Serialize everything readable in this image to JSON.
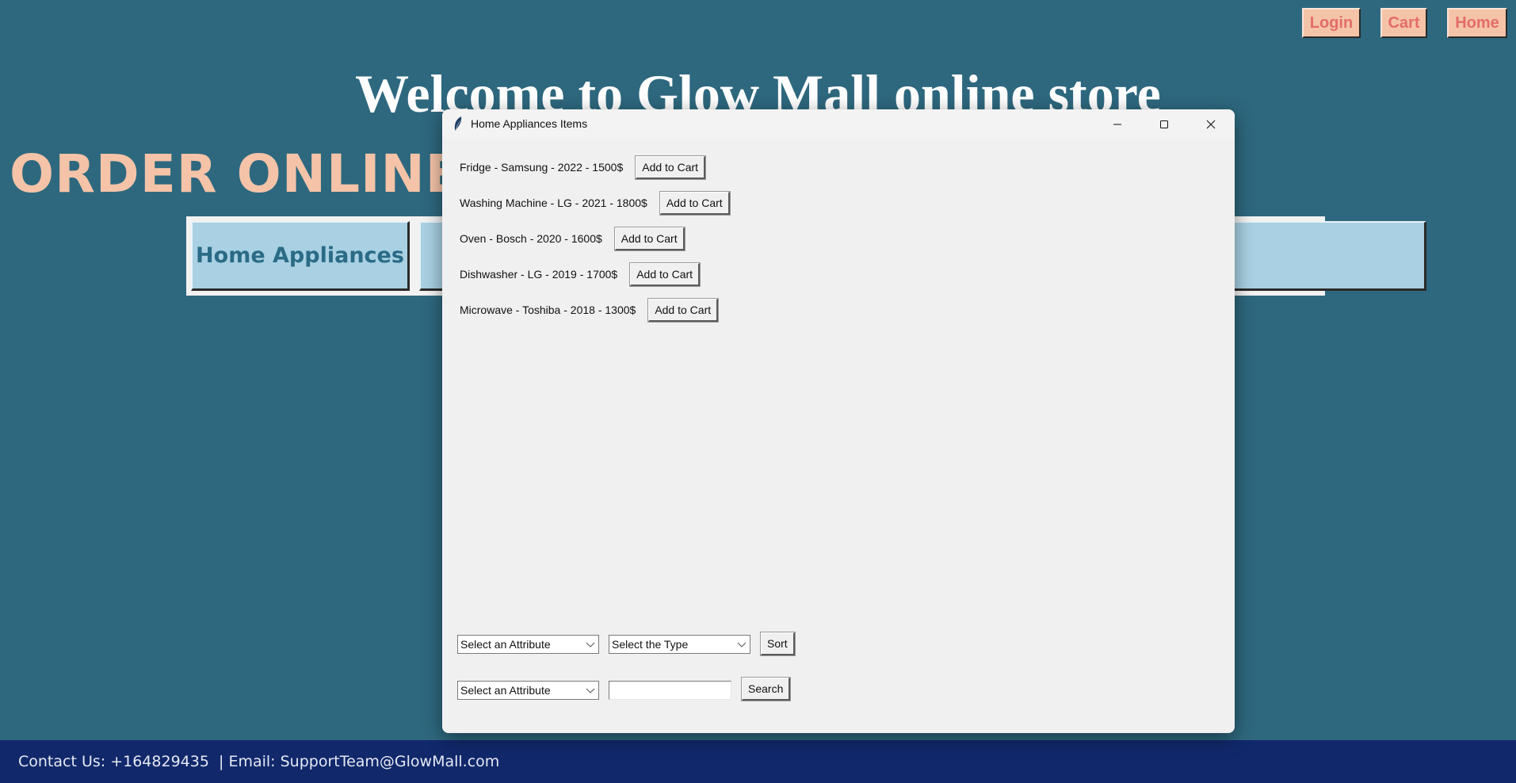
{
  "nav": {
    "login": "Login",
    "cart": "Cart",
    "home": "Home"
  },
  "header": {
    "welcome": "Welcome to Glow Mall online store",
    "order": "ORDER ONLINE"
  },
  "categories": {
    "first": "Home Appliances",
    "last_visible_fragment": "s"
  },
  "footer": {
    "contact": "Contact Us: +164829435  | Email: SupportTeam@GlowMall.com"
  },
  "dialog": {
    "title": "Home Appliances Items",
    "items": [
      {
        "label": "Fridge - Samsung - 2022 - 1500$",
        "button": "Add to Cart"
      },
      {
        "label": "Washing Machine - LG - 2021 - 1800$",
        "button": "Add to Cart"
      },
      {
        "label": "Oven - Bosch - 2020 - 1600$",
        "button": "Add to Cart"
      },
      {
        "label": "Dishwasher - LG - 2019 - 1700$",
        "button": "Add to Cart"
      },
      {
        "label": "Microwave - Toshiba - 2018 - 1300$",
        "button": "Add to Cart"
      }
    ],
    "sort": {
      "attribute": "Select an Attribute",
      "type": "Select the Type",
      "button": "Sort"
    },
    "search": {
      "attribute": "Select an Attribute",
      "value": "",
      "button": "Search"
    }
  }
}
